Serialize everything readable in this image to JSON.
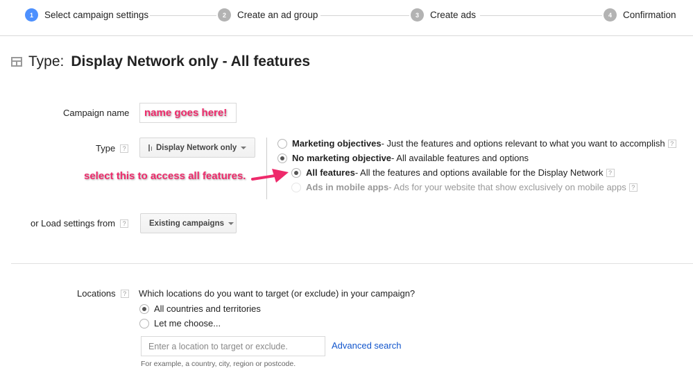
{
  "stepper": {
    "steps": [
      {
        "number": "1",
        "label": "Select campaign settings",
        "active": true
      },
      {
        "number": "2",
        "label": "Create an ad group",
        "active": false
      },
      {
        "number": "3",
        "label": "Create ads",
        "active": false
      },
      {
        "number": "4",
        "label": "Confirmation",
        "active": false
      }
    ]
  },
  "title": {
    "prefix": "Type:",
    "value": "Display Network only - All features"
  },
  "form": {
    "campaign_name_label": "Campaign name",
    "campaign_name_value": "name goes here!",
    "type_label": "Type",
    "type_dropdown": "Display Network only",
    "load_label": "or Load settings from",
    "load_dropdown": "Existing campaigns",
    "help_glyph": "?",
    "type_options": [
      {
        "bold": "Marketing objectives",
        "desc": " - Just the features and options relevant to what you want to accomplish",
        "checked": false,
        "disabled": false,
        "help": true
      },
      {
        "bold": "No marketing objective",
        "desc": " - All available features and options",
        "checked": true,
        "disabled": false,
        "help": false
      },
      {
        "bold": "All features",
        "desc": " - All the features and options available for the Display Network",
        "checked": true,
        "disabled": false,
        "help": true
      },
      {
        "bold": "Ads in mobile apps",
        "desc": " - Ads for your website that show exclusively on mobile apps",
        "checked": false,
        "disabled": true,
        "help": true
      }
    ]
  },
  "annotation": {
    "select_text": "select this to access all features.",
    "color": "#ee2a6b"
  },
  "locations": {
    "label": "Locations",
    "question": "Which locations do you want to target (or exclude) in your campaign?",
    "options": [
      {
        "label": "All countries and territories",
        "checked": true
      },
      {
        "label": "Let me choose...",
        "checked": false
      }
    ],
    "input_placeholder": "Enter a location to target or exclude.",
    "advanced_search": "Advanced search",
    "hint": "For example, a country, city, region or postcode."
  },
  "colors": {
    "accent": "#4d90fe",
    "link": "#1155cc"
  }
}
